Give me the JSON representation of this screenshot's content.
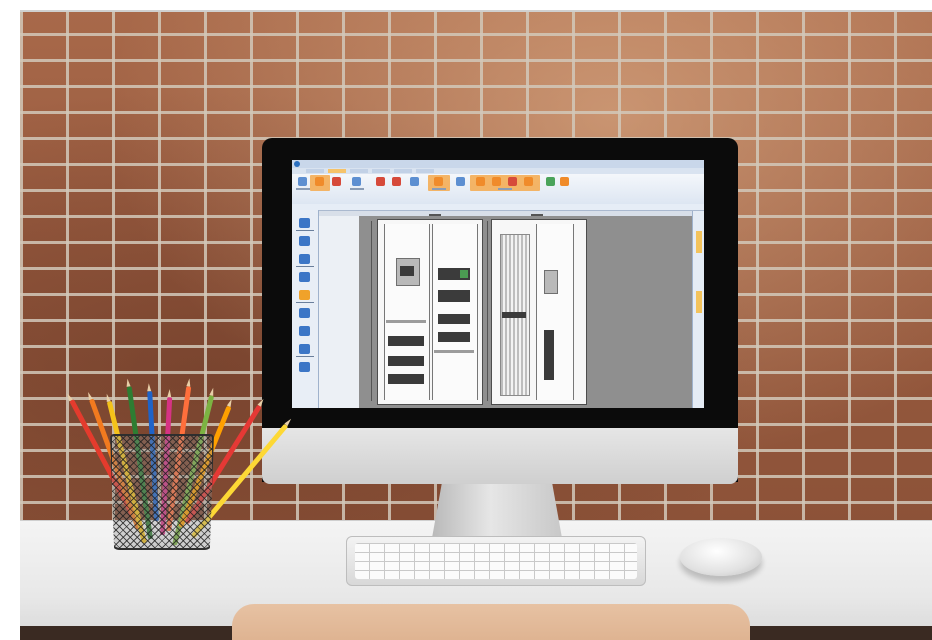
{
  "scene": {
    "description_labels": {
      "wall": "brick-wall",
      "monitor": "all-in-one-computer",
      "screen_app": "electrical-cabinet-design-software",
      "desk": "white-desk"
    }
  },
  "colors": {
    "brick": "#9a5c40",
    "mortar": "#d2c8b9",
    "desk": "#eeeeee",
    "ribbon_accent": "#f5a94c",
    "ui_blue": "#3c76c6"
  },
  "pencils": [
    "#e43b2d",
    "#f27a1f",
    "#f4c21a",
    "#2e7d32",
    "#1e63c9",
    "#d63384",
    "#ff6f3c",
    "#7cb342",
    "#ffa000",
    "#e53935",
    "#fdd835"
  ]
}
